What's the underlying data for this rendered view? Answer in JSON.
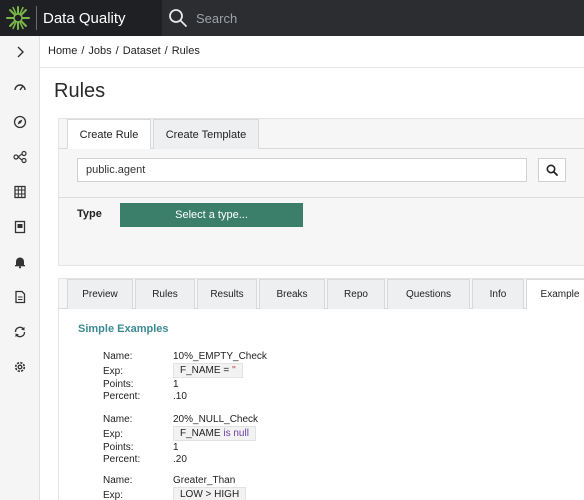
{
  "app": {
    "title": "Data Quality"
  },
  "search": {
    "placeholder": "Search"
  },
  "breadcrumb": [
    "Home",
    "Jobs",
    "Dataset",
    "Rules"
  ],
  "page": {
    "title": "Rules"
  },
  "rule_tabs": [
    "Create Rule",
    "Create Template"
  ],
  "dataset_input": {
    "value": "public.agent"
  },
  "type": {
    "label": "Type",
    "select_value": "Select a type..."
  },
  "info_tabs": [
    "Preview",
    "Rules",
    "Results",
    "Breaks",
    "Repo",
    "Questions",
    "Info",
    "Example"
  ],
  "examples": {
    "title": "Simple Examples",
    "keys": {
      "name": "Name:",
      "exp": "Exp:",
      "points": "Points:",
      "percent": "Percent:"
    },
    "items": [
      {
        "name": "10%_EMPTY_Check",
        "exp_col": "F_NAME",
        "exp_op": "=",
        "exp_rest": "''",
        "points": "1",
        "percent": ".10"
      },
      {
        "name": "20%_NULL_Check",
        "exp_col": "F_NAME",
        "exp_op": "is",
        "exp_rest": "null",
        "points": "1",
        "percent": ".20"
      },
      {
        "name": "Greater_Than",
        "exp_full": "LOW > HIGH"
      }
    ]
  },
  "colors": {
    "topbar": "#2b2d31",
    "brand": "#1f2023",
    "accent_green": "#3b7f6a",
    "section_teal": "#3b8a92",
    "logo_green": "#7ab648"
  },
  "icons": [
    "chevron-right-icon",
    "dashboard-icon",
    "compass-icon",
    "graph-icon",
    "calendar-grid-icon",
    "id-card-icon",
    "bell-icon",
    "report-icon",
    "sync-icon",
    "gear-icon",
    "search-icon"
  ]
}
